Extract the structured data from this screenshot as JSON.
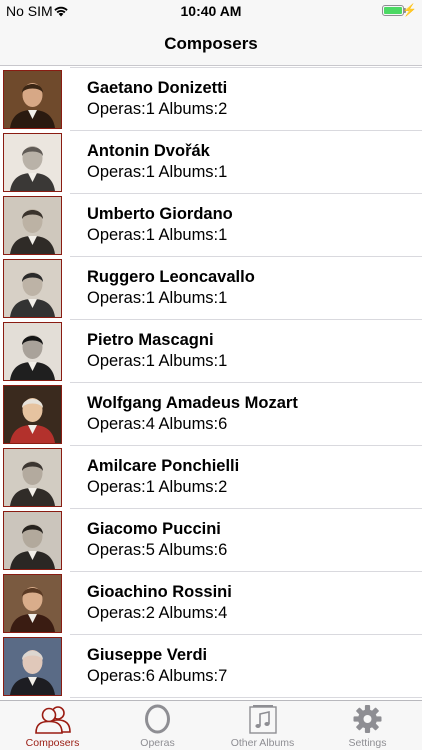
{
  "status_bar": {
    "carrier": "No SIM",
    "time": "10:40 AM",
    "battery_level": 1.0
  },
  "nav": {
    "title": "Composers"
  },
  "composers": [
    {
      "name": "Gaetano Donizetti",
      "details": "Operas:1 Albums:2",
      "palette": {
        "bg": "#6f4a2c",
        "coat": "#2a1a10",
        "face": "#d7a886",
        "hair": "#3b2615"
      }
    },
    {
      "name": "Antonin Dvořák",
      "details": "Operas:1 Albums:1",
      "palette": {
        "bg": "#ebe6df",
        "coat": "#3a3836",
        "face": "#b9b2a8",
        "hair": "#5f5a55"
      }
    },
    {
      "name": "Umberto Giordano",
      "details": "Operas:1 Albums:1",
      "palette": {
        "bg": "#cfc8bd",
        "coat": "#2f2b27",
        "face": "#bcb2a4",
        "hair": "#3a332c"
      }
    },
    {
      "name": "Ruggero Leoncavallo",
      "details": "Operas:1 Albums:1",
      "palette": {
        "bg": "#d7d0c6",
        "coat": "#333",
        "face": "#bdb3a6",
        "hair": "#2a2a2a"
      }
    },
    {
      "name": "Pietro Mascagni",
      "details": "Operas:1 Albums:1",
      "palette": {
        "bg": "#e3ded7",
        "coat": "#1f1f1f",
        "face": "#a9a29a",
        "hair": "#151515"
      }
    },
    {
      "name": "Wolfgang Amadeus Mozart",
      "details": "Operas:4 Albums:6",
      "palette": {
        "bg": "#3a2a1e",
        "coat": "#b3312c",
        "face": "#e6c3a0",
        "hair": "#e7e2da"
      }
    },
    {
      "name": "Amilcare Ponchielli",
      "details": "Operas:1 Albums:2",
      "palette": {
        "bg": "#d2ccc2",
        "coat": "#302c28",
        "face": "#b3aa9e",
        "hair": "#3c3631"
      }
    },
    {
      "name": "Giacomo Puccini",
      "details": "Operas:5 Albums:6",
      "palette": {
        "bg": "#cbc5bc",
        "coat": "#2a2724",
        "face": "#b2a99c",
        "hair": "#26221e"
      }
    },
    {
      "name": "Gioachino Rossini",
      "details": "Operas:2 Albums:4",
      "palette": {
        "bg": "#7a5a40",
        "coat": "#3a1c12",
        "face": "#d9ad8b",
        "hair": "#5a3a24"
      }
    },
    {
      "name": "Giuseppe Verdi",
      "details": "Operas:6 Albums:7",
      "palette": {
        "bg": "#5a6b86",
        "coat": "#1d1d22",
        "face": "#e0c8ba",
        "hair": "#dcd6d0"
      }
    }
  ],
  "tabs": [
    {
      "label": "Composers",
      "icon": "people-icon",
      "active": true
    },
    {
      "label": "Operas",
      "icon": "ring-o-icon",
      "active": false
    },
    {
      "label": "Other Albums",
      "icon": "music-note-icon",
      "active": false
    },
    {
      "label": "Settings",
      "icon": "gear-icon",
      "active": false
    }
  ],
  "colors": {
    "accent": "#9a1c12",
    "inactive": "#8e8e93",
    "bars": "#f7f7f7"
  }
}
